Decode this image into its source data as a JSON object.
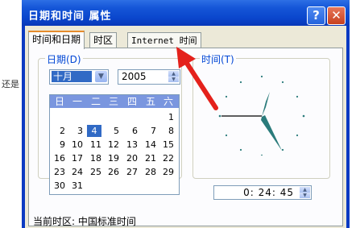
{
  "background": {
    "cutoff_text": "还是"
  },
  "window": {
    "title": "日期和时间 属性",
    "help_glyph": "?",
    "close_glyph": "✕"
  },
  "tabs": [
    {
      "label": "时间和日期",
      "active": true
    },
    {
      "label": "时区",
      "active": false
    },
    {
      "label": "Internet 时间",
      "active": false
    }
  ],
  "date_group": {
    "title": "日期(D)",
    "month_value": "十月",
    "year_value": "2005",
    "weekdays": [
      "日",
      "一",
      "二",
      "三",
      "四",
      "五",
      "六"
    ],
    "days": [
      [
        "",
        "",
        "",
        "",
        "",
        "",
        "1"
      ],
      [
        "2",
        "3",
        "4",
        "5",
        "6",
        "7",
        "8"
      ],
      [
        "9",
        "10",
        "11",
        "12",
        "13",
        "14",
        "15"
      ],
      [
        "16",
        "17",
        "18",
        "19",
        "20",
        "21",
        "22"
      ],
      [
        "23",
        "24",
        "25",
        "26",
        "27",
        "28",
        "29"
      ],
      [
        "30",
        "31",
        "",
        "",
        "",
        "",
        ""
      ]
    ],
    "selected_day": "4"
  },
  "time_group": {
    "title": "时间(T)",
    "time_value": "0: 24: 45"
  },
  "timezone": {
    "caption": "当前时区:",
    "name": "中国标准时间"
  },
  "colors": {
    "title_bar": "#0a46cc",
    "selection": "#316ac5",
    "calendar_header": "#7a96df",
    "clock_hands": "#2a7b7b",
    "group_title": "#0046d5",
    "annotation_arrow": "#e4211b"
  }
}
